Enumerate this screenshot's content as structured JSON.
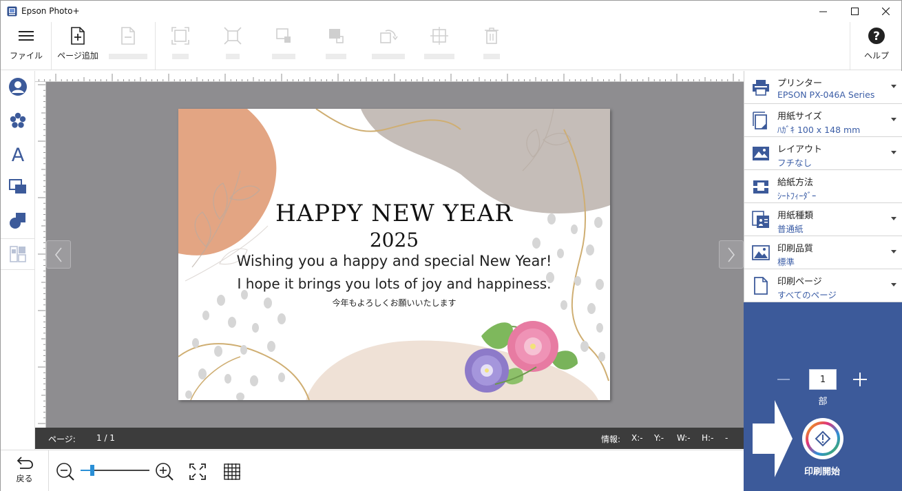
{
  "window": {
    "title": "Epson Photo+"
  },
  "toolbar": {
    "file_label": "ファイル",
    "add_page_label": "ページ追加",
    "help_label": "ヘルプ"
  },
  "rail": {
    "icons": [
      "person-icon",
      "flower-stamp-icon",
      "text-icon",
      "image-frame-icon",
      "shapes-icon",
      "layout-template-icon"
    ]
  },
  "card": {
    "headline": "HAPPY NEW YEAR",
    "year": "2025",
    "line1": "Wishing you a happy and special New Year!",
    "line2": "I hope it brings you lots of joy and happiness.",
    "jp": "今年もよろしくお願いいたします"
  },
  "status": {
    "page_label": "ページ:",
    "page_value": "1 / 1",
    "info_label": "情報:",
    "x": "X:-",
    "y": "Y:-",
    "w": "W:-",
    "h": "H:-",
    "dash": "-"
  },
  "bottom": {
    "back_label": "戻る"
  },
  "settings": [
    {
      "name": "プリンター",
      "value": "EPSON PX-046A Series",
      "icon": "printer-icon"
    },
    {
      "name": "用紙サイズ",
      "value": "ﾊｶﾞｷ 100 x 148 mm",
      "icon": "paper-size-icon"
    },
    {
      "name": "レイアウト",
      "value": "フチなし",
      "icon": "layout-icon"
    },
    {
      "name": "給紙方法",
      "value": "ｼｰﾄﾌｨｰﾀﾞｰ",
      "icon": "paper-feed-icon"
    },
    {
      "name": "用紙種類",
      "value": "普通紙",
      "icon": "paper-type-icon"
    },
    {
      "name": "印刷品質",
      "value": "標準",
      "icon": "print-quality-icon"
    },
    {
      "name": "印刷ページ",
      "value": "すべてのページ",
      "icon": "print-pages-icon"
    }
  ],
  "print": {
    "copies": "1",
    "copies_unit": "部",
    "start_label": "印刷開始"
  },
  "colors": {
    "panel_blue": "#3c5a9a",
    "link_blue": "#3b5da6",
    "canvas_gray": "#8e8d90",
    "status_dark": "#3c3c3c",
    "slider_blue": "#2a8fd6"
  },
  "zoom": {
    "level_fraction": 0.17
  }
}
